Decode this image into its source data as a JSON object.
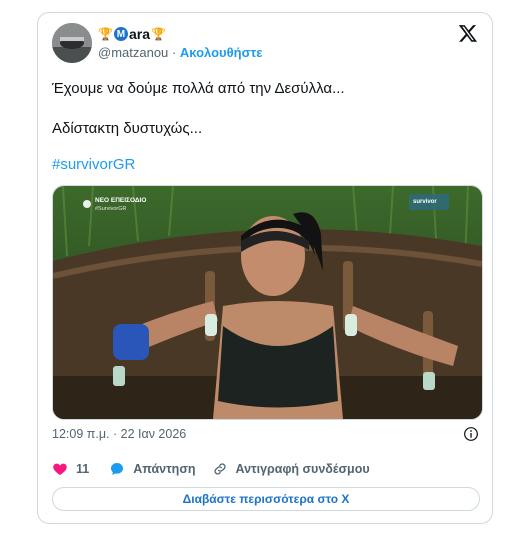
{
  "user": {
    "display_prefix_icon": "trophy-icon",
    "badge_letter": "M",
    "display_name": "ara",
    "display_suffix_icon": "trophy-icon",
    "handle": "@matzanou",
    "separator": "·",
    "follow_label": "Ακολουθήστε"
  },
  "tweet": {
    "line1": "Έχουμε να δούμε πολλά από την Δεσύλλα...",
    "line2": "Αδίστακτη δυστυχώς...",
    "hashtag": "#survivorGR"
  },
  "media": {
    "badge_new": "ΝΕΟ ΕΠΕΙΣΟΔΙΟ",
    "badge_tag": "#SurvivorGR",
    "logo_text": "survivor"
  },
  "meta": {
    "timestamp": "12:09 π.μ. · 22 Ιαν 2026"
  },
  "actions": {
    "like_count": "11",
    "reply_label": "Απάντηση",
    "copy_link_label": "Αντιγραφή συνδέσμου"
  },
  "cta": {
    "label": "Διαβάστε περισσότερα στο X"
  },
  "colors": {
    "accent": "#1d9bf0",
    "like": "#f91880",
    "muted": "#536471"
  }
}
